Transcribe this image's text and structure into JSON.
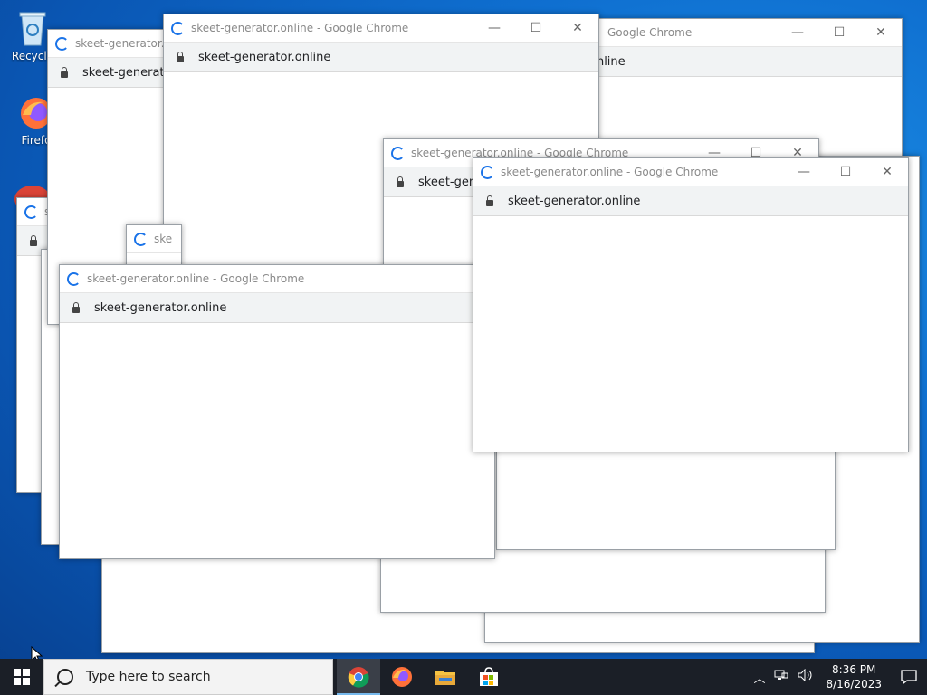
{
  "desktop": {
    "icons": [
      {
        "label": "Recycle"
      },
      {
        "label": "Firefo"
      }
    ]
  },
  "windows": {
    "title": "skeet-generator.online - Google Chrome",
    "url": "skeet-generator.online",
    "title_truncated": "skeet-generator.onl",
    "url_truncated_a": "skeet-generato",
    "url_truncated_b": "skeet-gene",
    "title_suffix": "Google Chrome",
    "url_suffix": "online",
    "title_tiny": "sk",
    "title_tiny2": "ske"
  },
  "taskbar": {
    "search_placeholder": "Type here to search",
    "time": "8:36 PM",
    "date": "8/16/2023"
  }
}
